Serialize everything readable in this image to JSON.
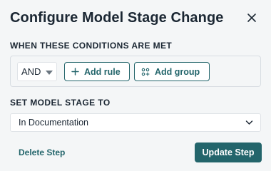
{
  "dialog": {
    "title": "Configure Model Stage Change",
    "close_icon": "close-icon"
  },
  "conditions": {
    "label": "WHEN THESE CONDITIONS ARE MET",
    "operator": "AND",
    "add_rule_label": "Add rule",
    "add_rule_icon": "plus-icon",
    "add_group_label": "Add group",
    "add_group_icon": "group-icon"
  },
  "stage": {
    "label": "SET MODEL STAGE TO",
    "selected": "In Documentation",
    "dropdown_icon": "chevron-down-icon"
  },
  "footer": {
    "delete_label": "Delete Step",
    "update_label": "Update Step"
  },
  "colors": {
    "accent": "#23656b",
    "panel_bg": "#f4f6f7",
    "text": "#1b2733"
  }
}
